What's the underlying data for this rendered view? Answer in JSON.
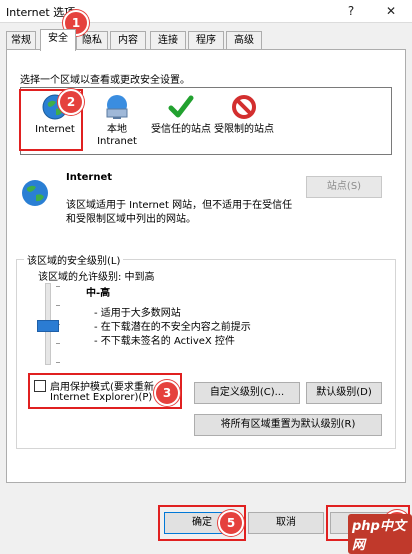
{
  "window": {
    "title": "Internet 选项",
    "help": "?",
    "close": "✕"
  },
  "tabs": [
    {
      "label": "常规"
    },
    {
      "label": "安全"
    },
    {
      "label": "隐私"
    },
    {
      "label": "内容"
    },
    {
      "label": "连接"
    },
    {
      "label": "程序"
    },
    {
      "label": "高级"
    }
  ],
  "security": {
    "instruction": "选择一个区域以查看或更改安全设置。",
    "zones": [
      {
        "label": "Internet",
        "icon": "globe-icon"
      },
      {
        "label": "本地\nIntranet",
        "icon": "intranet-icon"
      },
      {
        "label": "受信任的站点",
        "icon": "checkmark-icon"
      },
      {
        "label": "受限制的站点",
        "icon": "prohibited-icon"
      }
    ],
    "selected_zone": {
      "title": "Internet",
      "desc_line1": "该区域适用于 Internet 网站，但不适用于在受信任",
      "desc_line2": "和受限制区域中列出的网站。",
      "sites_button": "站点(S)"
    },
    "level_group": {
      "title": "该区域的安全级别(L)",
      "allowed": "该区域的允许级别: 中到高",
      "level_name": "中-高",
      "bullets": [
        "- 适用于大多数网站",
        "- 在下载潜在的不安全内容之前提示",
        "- 不下载未签名的 ActiveX 控件"
      ],
      "slider_level_fraction": 0.5,
      "protected_mode_line1": "启用保护模式(要求重新",
      "protected_mode_line2": "Internet Explorer)(P)",
      "custom_button": "自定义级别(C)...",
      "default_button": "默认级别(D)",
      "reset_all_button": "将所有区域重置为默认级别(R)"
    }
  },
  "footer": {
    "ok": "确定",
    "cancel": "取消",
    "apply": "应用(A)"
  },
  "annotations": [
    "1",
    "2",
    "3",
    "4",
    "5"
  ],
  "watermark": "php中文网",
  "colors": {
    "highlight": "#e02020",
    "badge": "#e5413d",
    "slider": "#2b7cd3"
  }
}
